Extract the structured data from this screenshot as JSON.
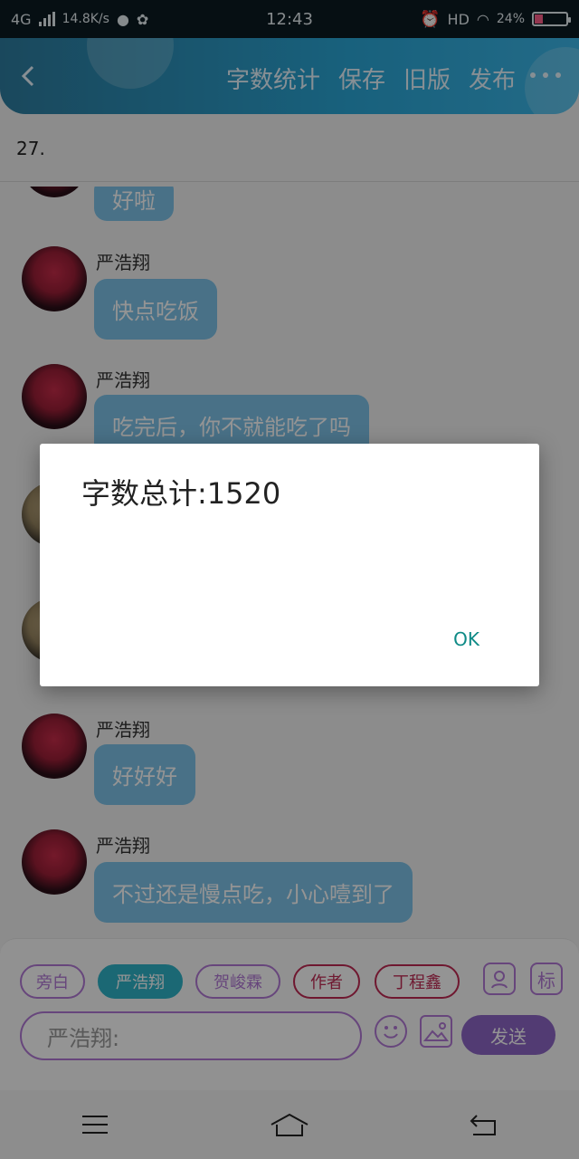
{
  "status_bar": {
    "network": "4G",
    "speed": "14.8K/s",
    "time": "12:43",
    "hd": "HD",
    "battery_text": "24%",
    "battery_level": 0.24,
    "battery_color": "#ff5f8a"
  },
  "header": {
    "actions": [
      "字数统计",
      "保存",
      "旧版",
      "发布"
    ]
  },
  "subtitle": "27.",
  "chat": {
    "messages": [
      {
        "name": "",
        "text": "好啦"
      },
      {
        "name": "严浩翔",
        "text": "快点吃饭"
      },
      {
        "name": "严浩翔",
        "text": "吃完后，你不就能吃了吗"
      },
      {
        "name": "严浩翔",
        "text": "好好好"
      },
      {
        "name": "严浩翔",
        "text": "不过还是慢点吃，小心噎到了"
      }
    ]
  },
  "dialog": {
    "message": "字数总计:1520",
    "ok_label": "OK"
  },
  "composer": {
    "chips": [
      "旁白",
      "严浩翔",
      "贺峻霖",
      "作者",
      "丁程鑫"
    ],
    "mark_label": "标",
    "input_value": "严浩翔:",
    "send_label": "发送",
    "accent_color": "#b279d6"
  }
}
